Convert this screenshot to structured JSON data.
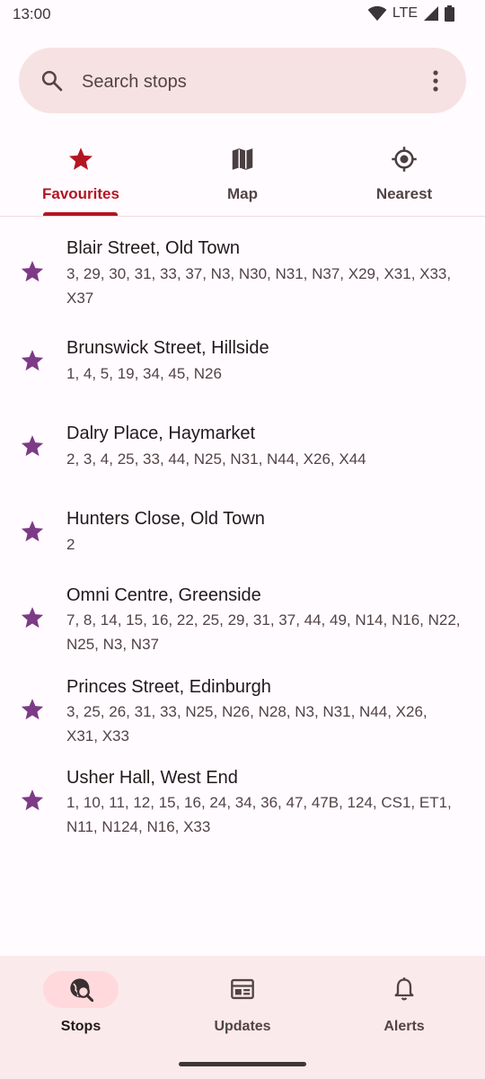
{
  "status": {
    "time": "13:00",
    "network": "LTE",
    "icons": [
      "wifi-icon",
      "signal-icon",
      "battery-icon"
    ]
  },
  "search": {
    "placeholder": "Search stops",
    "value": ""
  },
  "tabs": [
    {
      "label": "Favourites",
      "icon": "star-icon",
      "active": true
    },
    {
      "label": "Map",
      "icon": "map-icon",
      "active": false
    },
    {
      "label": "Nearest",
      "icon": "location-icon",
      "active": false
    }
  ],
  "stops": [
    {
      "name": "Blair Street, Old Town",
      "services": "3, 29, 30, 31, 33, 37, N3, N30, N31, N37, X29, X31, X33, X37"
    },
    {
      "name": "Brunswick Street, Hillside",
      "services": "1, 4, 5, 19, 34, 45, N26"
    },
    {
      "name": "Dalry Place, Haymarket",
      "services": "2, 3, 4, 25, 33, 44, N25, N31, N44, X26, X44"
    },
    {
      "name": "Hunters Close, Old Town",
      "services": "2"
    },
    {
      "name": "Omni Centre, Greenside",
      "services": "7, 8, 14, 15, 16, 22, 25, 29, 31, 37, 44, 49, N14, N16, N22, N25, N3, N37"
    },
    {
      "name": "Princes Street, Edinburgh",
      "services": "3, 25, 26, 31, 33, N25, N26, N28, N3, N31, N44, X26, X31, X33"
    },
    {
      "name": "Usher Hall, West End",
      "services": "1, 10, 11, 12, 15, 16, 24, 34, 36, 47, 47B, 124, CS1, ET1, N11, N124, N16, X33"
    }
  ],
  "nav": [
    {
      "label": "Stops",
      "icon": "stops-search-icon",
      "active": true
    },
    {
      "label": "Updates",
      "icon": "updates-icon",
      "active": false
    },
    {
      "label": "Alerts",
      "icon": "bell-icon",
      "active": false
    }
  ],
  "colors": {
    "accent": "#b31622",
    "star": "#7d3a86",
    "surface": "#fffbff",
    "search_bg": "#f6e2e3",
    "nav_bg": "#fbeaec",
    "nav_pill": "#ffd9dc"
  }
}
